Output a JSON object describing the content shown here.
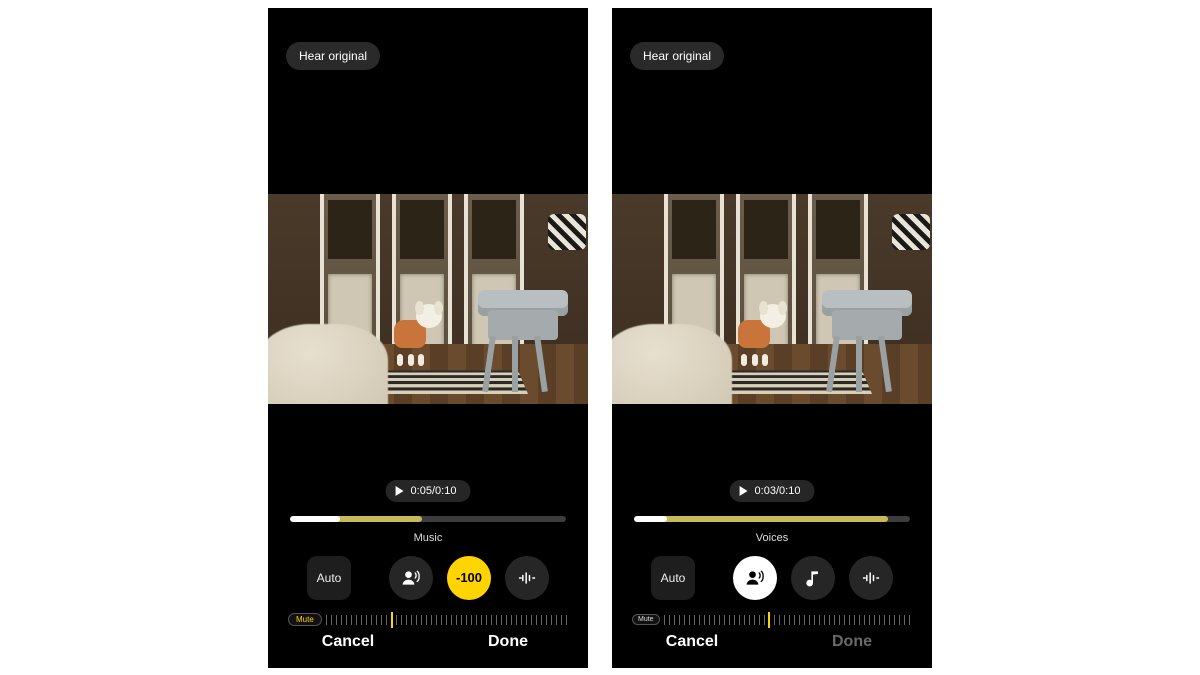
{
  "screens": [
    {
      "hear_original": "Hear original",
      "playback": {
        "current": "0:05",
        "total": "0:10"
      },
      "timeline": {
        "white_pct": 18,
        "yellow_pct": 30
      },
      "category_label": "Music",
      "auto_label": "Auto",
      "active_mode": "music",
      "active_style": "yellow",
      "value_text": "-100",
      "mute_label": "Mute",
      "ruler_marker_pct": 27,
      "done_enabled": true,
      "cancel": "Cancel",
      "done": "Done",
      "mute_variant": "yellow"
    },
    {
      "hear_original": "Hear original",
      "playback": {
        "current": "0:03",
        "total": "0:10"
      },
      "timeline": {
        "white_pct": 12,
        "yellow_pct": 80
      },
      "category_label": "Voices",
      "auto_label": "Auto",
      "active_mode": "voices",
      "active_style": "white",
      "value_text": "",
      "mute_label": "Mute",
      "ruler_marker_pct": 42,
      "done_enabled": false,
      "cancel": "Cancel",
      "done": "Done",
      "mute_variant": "small"
    }
  ],
  "colors": {
    "accent": "#ffd400"
  }
}
